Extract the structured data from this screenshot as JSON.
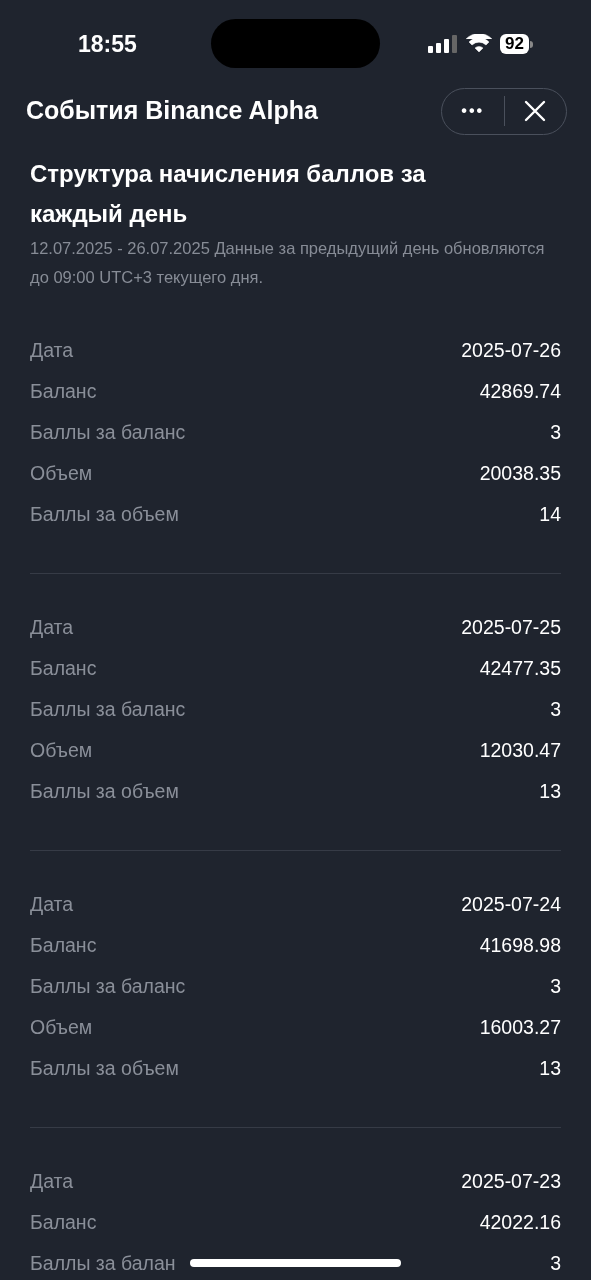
{
  "status_bar": {
    "time": "18:55",
    "battery": "92"
  },
  "header": {
    "title": "События Binance Alpha",
    "more_icon": "•••"
  },
  "section": {
    "title": "Структура начисления баллов за каждый день",
    "subtitle": "12.07.2025 - 26.07.2025 Данные за предыдущий день обновляются до 09:00 UTC+3 текущего дня."
  },
  "days": [
    {
      "rows": [
        {
          "label": "Дата",
          "value": "2025-07-26"
        },
        {
          "label": "Баланс",
          "value": "42869.74"
        },
        {
          "label": "Баллы за баланс",
          "value": "3"
        },
        {
          "label": "Объем",
          "value": "20038.35"
        },
        {
          "label": "Баллы за объем",
          "value": "14"
        }
      ]
    },
    {
      "rows": [
        {
          "label": "Дата",
          "value": "2025-07-25"
        },
        {
          "label": "Баланс",
          "value": "42477.35"
        },
        {
          "label": "Баллы за баланс",
          "value": "3"
        },
        {
          "label": "Объем",
          "value": "12030.47"
        },
        {
          "label": "Баллы за объем",
          "value": "13"
        }
      ]
    },
    {
      "rows": [
        {
          "label": "Дата",
          "value": "2025-07-24"
        },
        {
          "label": "Баланс",
          "value": "41698.98"
        },
        {
          "label": "Баллы за баланс",
          "value": "3"
        },
        {
          "label": "Объем",
          "value": "16003.27"
        },
        {
          "label": "Баллы за объем",
          "value": "13"
        }
      ]
    },
    {
      "rows": [
        {
          "label": "Дата",
          "value": "2025-07-23"
        },
        {
          "label": "Баланс",
          "value": "42022.16"
        },
        {
          "label": "Баллы за балан",
          "value": "3"
        }
      ]
    }
  ]
}
